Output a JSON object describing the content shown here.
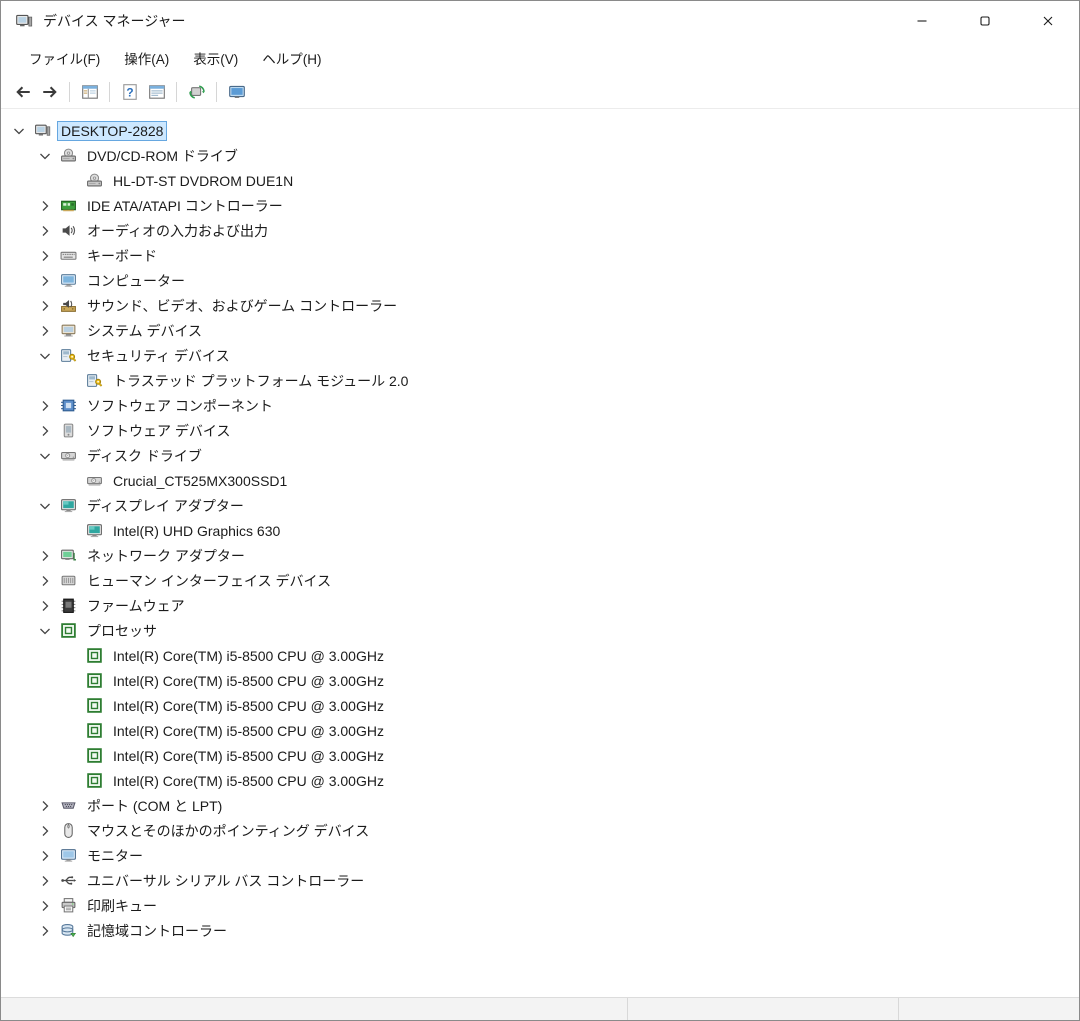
{
  "window": {
    "title": "デバイス マネージャー"
  },
  "menubar": {
    "items": [
      {
        "label": "ファイル(F)"
      },
      {
        "label": "操作(A)"
      },
      {
        "label": "表示(V)"
      },
      {
        "label": "ヘルプ(H)"
      }
    ]
  },
  "toolbar": {
    "groups": [
      [
        "back",
        "forward"
      ],
      [
        "console-tree"
      ],
      [
        "help",
        "list-view"
      ],
      [
        "scan-hardware"
      ],
      [
        "device-display"
      ]
    ]
  },
  "tree": {
    "root": {
      "label": "DESKTOP-2828",
      "icon": "computer",
      "selected": true,
      "expanded": true,
      "children": [
        {
          "label": "DVD/CD-ROM ドライブ",
          "icon": "dvd-drive",
          "expanded": true,
          "children": [
            {
              "label": "HL-DT-ST DVDROM DUE1N",
              "icon": "dvd-drive"
            }
          ]
        },
        {
          "label": "IDE ATA/ATAPI コントローラー",
          "icon": "ide-controller",
          "collapsed": true
        },
        {
          "label": "オーディオの入力および出力",
          "icon": "audio-endpoint",
          "collapsed": true
        },
        {
          "label": "キーボード",
          "icon": "keyboard",
          "collapsed": true
        },
        {
          "label": "コンピューター",
          "icon": "computer-category",
          "collapsed": true
        },
        {
          "label": "サウンド、ビデオ、およびゲーム コントローラー",
          "icon": "sound-controller",
          "collapsed": true
        },
        {
          "label": "システム デバイス",
          "icon": "system-device",
          "collapsed": true
        },
        {
          "label": "セキュリティ デバイス",
          "icon": "security-device",
          "expanded": true,
          "children": [
            {
              "label": "トラステッド プラットフォーム モジュール 2.0",
              "icon": "security-device"
            }
          ]
        },
        {
          "label": "ソフトウェア コンポーネント",
          "icon": "software-component",
          "collapsed": true
        },
        {
          "label": "ソフトウェア デバイス",
          "icon": "software-device",
          "collapsed": true
        },
        {
          "label": "ディスク ドライブ",
          "icon": "disk-drive",
          "expanded": true,
          "children": [
            {
              "label": "Crucial_CT525MX300SSD1",
              "icon": "disk-drive"
            }
          ]
        },
        {
          "label": "ディスプレイ アダプター",
          "icon": "display-adapter",
          "expanded": true,
          "children": [
            {
              "label": "Intel(R) UHD Graphics 630",
              "icon": "display-adapter"
            }
          ]
        },
        {
          "label": "ネットワーク アダプター",
          "icon": "network-adapter",
          "collapsed": true
        },
        {
          "label": "ヒューマン インターフェイス デバイス",
          "icon": "hid-device",
          "collapsed": true
        },
        {
          "label": "ファームウェア",
          "icon": "firmware",
          "collapsed": true
        },
        {
          "label": "プロセッサ",
          "icon": "processor",
          "expanded": true,
          "children": [
            {
              "label": "Intel(R) Core(TM) i5-8500 CPU @ 3.00GHz",
              "icon": "processor"
            },
            {
              "label": "Intel(R) Core(TM) i5-8500 CPU @ 3.00GHz",
              "icon": "processor"
            },
            {
              "label": "Intel(R) Core(TM) i5-8500 CPU @ 3.00GHz",
              "icon": "processor"
            },
            {
              "label": "Intel(R) Core(TM) i5-8500 CPU @ 3.00GHz",
              "icon": "processor"
            },
            {
              "label": "Intel(R) Core(TM) i5-8500 CPU @ 3.00GHz",
              "icon": "processor"
            },
            {
              "label": "Intel(R) Core(TM) i5-8500 CPU @ 3.00GHz",
              "icon": "processor"
            }
          ]
        },
        {
          "label": "ポート (COM と LPT)",
          "icon": "port",
          "collapsed": true
        },
        {
          "label": "マウスとそのほかのポインティング デバイス",
          "icon": "mouse",
          "collapsed": true
        },
        {
          "label": "モニター",
          "icon": "monitor",
          "collapsed": true
        },
        {
          "label": "ユニバーサル シリアル バス コントローラー",
          "icon": "usb-controller",
          "collapsed": true
        },
        {
          "label": "印刷キュー",
          "icon": "print-queue",
          "collapsed": true
        },
        {
          "label": "記憶域コントローラー",
          "icon": "storage-controller",
          "collapsed": true
        }
      ]
    }
  }
}
